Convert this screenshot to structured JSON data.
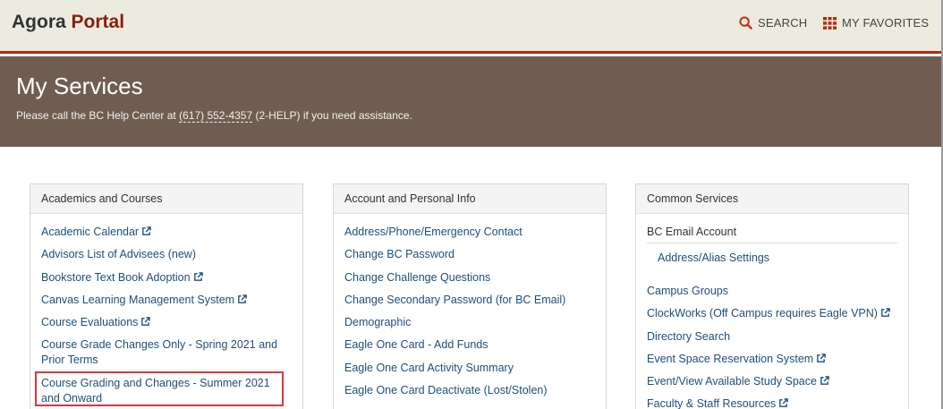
{
  "header": {
    "brand_first": "Agora",
    "brand_second": "Portal",
    "search_label": "SEARCH",
    "favorites_label": "MY FAVORITES"
  },
  "hero": {
    "title": "My Services",
    "help_prefix": "Please call the BC Help Center at ",
    "help_phone": "(617) 552-4357",
    "help_suffix": " (2-HELP) if you need assistance."
  },
  "panels": [
    {
      "title": "Academics and Courses",
      "items": [
        {
          "label": "Academic Calendar",
          "external": true
        },
        {
          "label": "Advisors List of Advisees (new)",
          "external": false
        },
        {
          "label": "Bookstore Text Book Adoption",
          "external": true
        },
        {
          "label": "Canvas Learning Management System",
          "external": true
        },
        {
          "label": "Course Evaluations",
          "external": true
        },
        {
          "label": "Course Grade Changes Only - Spring 2021 and Prior Terms",
          "external": false
        },
        {
          "label": "Course Grading and Changes - Summer 2021 and Onward",
          "external": false
        }
      ]
    },
    {
      "title": "Account and Personal Info",
      "items": [
        {
          "label": "Address/Phone/Emergency Contact",
          "external": false
        },
        {
          "label": "Change BC Password",
          "external": false
        },
        {
          "label": "Change Challenge Questions",
          "external": false
        },
        {
          "label": "Change Secondary Password (for BC Email)",
          "external": false
        },
        {
          "label": "Demographic",
          "external": false
        },
        {
          "label": "Eagle One Card - Add Funds",
          "external": false
        },
        {
          "label": "Eagle One Card Activity Summary",
          "external": false
        },
        {
          "label": "Eagle One Card Deactivate (Lost/Stolen)",
          "external": false
        }
      ]
    },
    {
      "title": "Common Services",
      "subheading": "BC Email Account",
      "sub_item": "Address/Alias Settings",
      "items": [
        {
          "label": "Campus Groups",
          "external": false
        },
        {
          "label": "ClockWorks (Off Campus requires Eagle VPN)",
          "external": true
        },
        {
          "label": "Directory Search",
          "external": false
        },
        {
          "label": "Event Space Reservation System",
          "external": true
        },
        {
          "label": "Event/View Available Study Space",
          "external": true
        },
        {
          "label": "Faculty & Staff Resources",
          "external": true
        }
      ]
    }
  ],
  "colors": {
    "brand_accent": "#8a1c0c",
    "header_bg": "#ecebdf",
    "hero_bg": "#705d52",
    "link": "#1f4f7a",
    "highlight": "#d9373b"
  },
  "icons": {
    "search": "search-icon",
    "favorites": "grid-icon",
    "external": "external-link-icon"
  }
}
